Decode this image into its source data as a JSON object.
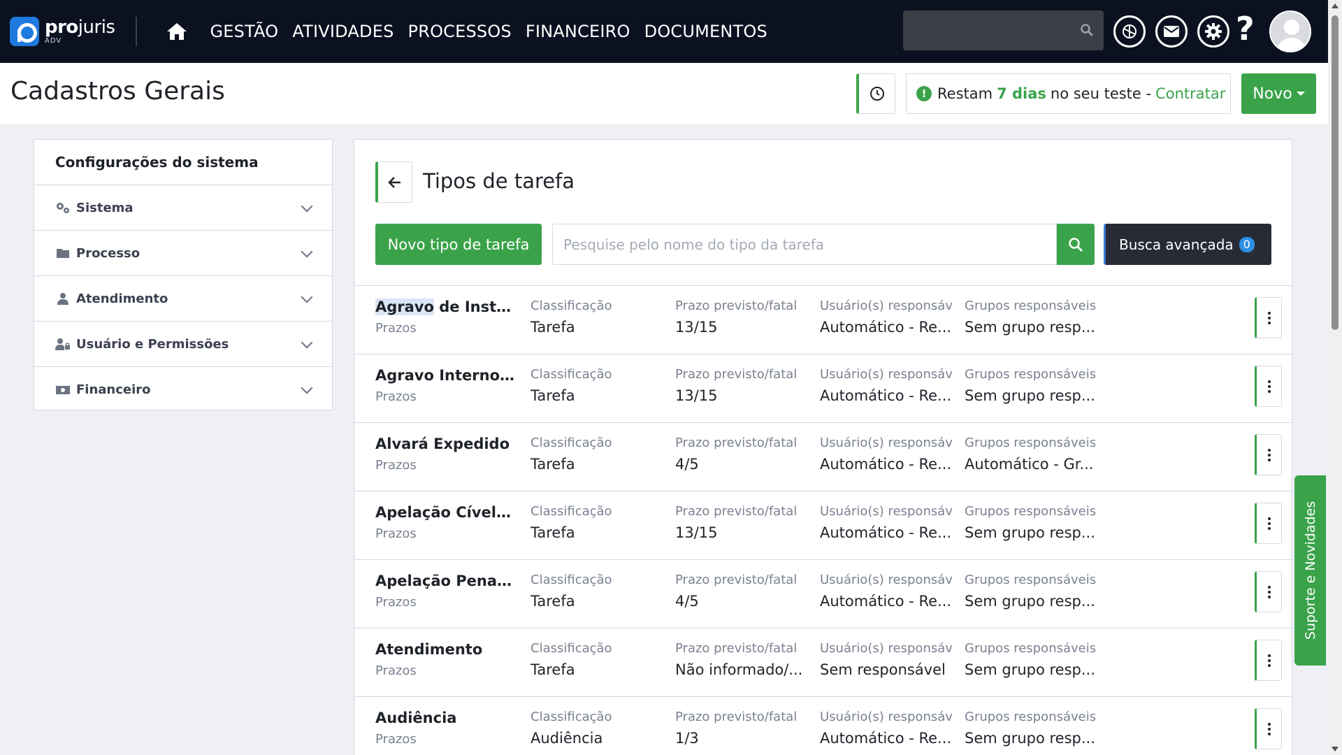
{
  "brand": {
    "name_bold": "pro",
    "name_rest": "juris",
    "sub": "ADV"
  },
  "nav": {
    "items": [
      "GESTÃO",
      "ATIVIDADES",
      "PROCESSOS",
      "FINANCEIRO",
      "DOCUMENTOS"
    ]
  },
  "header": {
    "title": "Cadastros Gerais",
    "trial_prefix": "Restam",
    "trial_days": "7 dias",
    "trial_middle": "no seu teste -",
    "trial_link": "Contratar",
    "new_label": "Novo"
  },
  "sidebar": {
    "title": "Configurações do sistema",
    "items": [
      {
        "label": "Sistema",
        "icon": "gears-icon"
      },
      {
        "label": "Processo",
        "icon": "folder-icon"
      },
      {
        "label": "Atendimento",
        "icon": "user-icon"
      },
      {
        "label": "Usuário e Permissões",
        "icon": "user-lock-icon"
      },
      {
        "label": "Financeiro",
        "icon": "money-icon"
      }
    ]
  },
  "main": {
    "title": "Tipos de tarefa",
    "new_button": "Novo tipo de tarefa",
    "search_placeholder": "Pesquise pelo nome do tipo da tarefa",
    "advanced_search": "Busca avançada",
    "advanced_count": "0",
    "col_labels": {
      "classification": "Classificação",
      "deadline": "Prazo previsto/fatal",
      "users": "Usuário(s) responsáveis",
      "groups": "Grupos responsáveis"
    },
    "rows": [
      {
        "name_hl": "Agravo",
        "name_rest": " de Instr...",
        "category": "Prazos",
        "classification": "Tarefa",
        "deadline": "13/15",
        "users": "Automático - Re...",
        "groups": "Sem grupo resp..."
      },
      {
        "name_hl": "",
        "name_rest": "Agravo Interno ...",
        "category": "Prazos",
        "classification": "Tarefa",
        "deadline": "13/15",
        "users": "Automático - Re...",
        "groups": "Sem grupo resp..."
      },
      {
        "name_hl": "",
        "name_rest": "Alvará Expedido",
        "category": "Prazos",
        "classification": "Tarefa",
        "deadline": "4/5",
        "users": "Automático - Re...",
        "groups": "Automático - Gr..."
      },
      {
        "name_hl": "",
        "name_rest": "Apelação Cível ...",
        "category": "Prazos",
        "classification": "Tarefa",
        "deadline": "13/15",
        "users": "Automático - Re...",
        "groups": "Sem grupo resp..."
      },
      {
        "name_hl": "",
        "name_rest": "Apelação Penal ...",
        "category": "Prazos",
        "classification": "Tarefa",
        "deadline": "4/5",
        "users": "Automático - Re...",
        "groups": "Sem grupo resp..."
      },
      {
        "name_hl": "",
        "name_rest": "Atendimento",
        "category": "Prazos",
        "classification": "Tarefa",
        "deadline": "Não informado/...",
        "users": "Sem responsável",
        "groups": "Sem grupo resp..."
      },
      {
        "name_hl": "",
        "name_rest": "Audiência",
        "category": "Prazos",
        "classification": "Audiência",
        "deadline": "1/3",
        "users": "Automático - Re...",
        "groups": "Sem grupo resp..."
      }
    ]
  },
  "support": {
    "label": "Suporte e Novidades"
  },
  "colors": {
    "accent": "#3aa34a",
    "nav_bg": "#0b1120",
    "brand_blue": "#1f7ae0"
  }
}
